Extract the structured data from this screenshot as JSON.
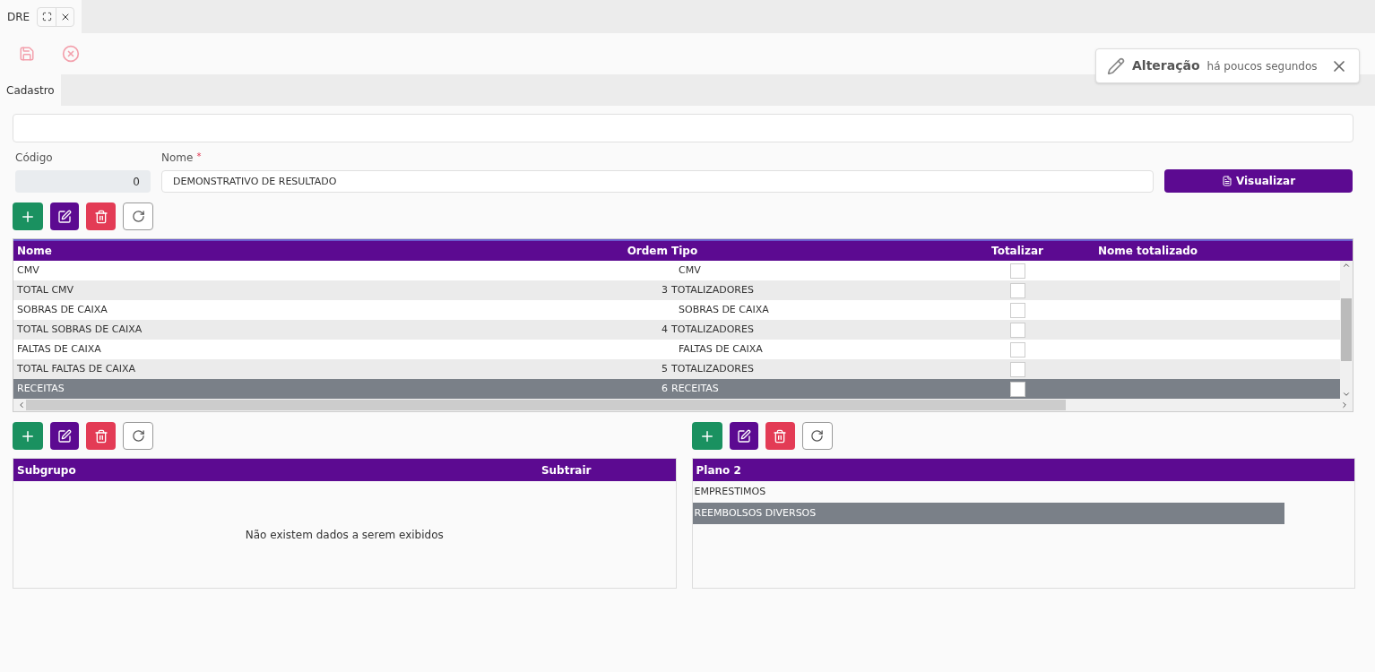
{
  "window_tab": {
    "title": "DRE"
  },
  "toolbar": {
    "save_disabled": true,
    "cancel_disabled": true
  },
  "notification": {
    "action": "Alteração",
    "time": "há poucos segundos"
  },
  "form_tabs": [
    {
      "label": "Cadastro",
      "selected": true
    }
  ],
  "fields": {
    "codigo": {
      "label": "Código",
      "value": "0"
    },
    "nome": {
      "label": "Nome",
      "required_mark": "*",
      "value": "DEMONSTRATIVO DE RESULTADO"
    }
  },
  "visualizar_button": "Visualizar",
  "main_table": {
    "columns": [
      "Nome",
      "Ordem",
      "Tipo",
      "Totalizar",
      "Nome totalizado"
    ],
    "rows": [
      {
        "nome": "CMV",
        "ordem": "",
        "tipo": "CMV",
        "totalizar": false,
        "selected": false
      },
      {
        "nome": "TOTAL CMV",
        "ordem": "3",
        "tipo": "TOTALIZADORES",
        "totalizar": false,
        "selected": false
      },
      {
        "nome": "SOBRAS DE CAIXA",
        "ordem": "",
        "tipo": "SOBRAS DE CAIXA",
        "totalizar": false,
        "selected": false
      },
      {
        "nome": "TOTAL SOBRAS DE CAIXA",
        "ordem": "4",
        "tipo": "TOTALIZADORES",
        "totalizar": false,
        "selected": false
      },
      {
        "nome": "FALTAS DE CAIXA",
        "ordem": "",
        "tipo": "FALTAS DE CAIXA",
        "totalizar": false,
        "selected": false
      },
      {
        "nome": "TOTAL FALTAS DE CAIXA",
        "ordem": "5",
        "tipo": "TOTALIZADORES",
        "totalizar": false,
        "selected": false
      },
      {
        "nome": "RECEITAS",
        "ordem": "6",
        "tipo": "RECEITAS",
        "totalizar": false,
        "selected": true
      }
    ]
  },
  "subgrupo_table": {
    "columns": [
      "Subgrupo",
      "Subtrair"
    ],
    "empty_message": "Não existem dados a serem exibidos"
  },
  "plano_table": {
    "columns": [
      "Plano 2"
    ],
    "rows": [
      {
        "name": "EMPRESTIMOS",
        "selected": false
      },
      {
        "name": "REEMBOLSOS DIVERSOS",
        "selected": true
      }
    ]
  }
}
